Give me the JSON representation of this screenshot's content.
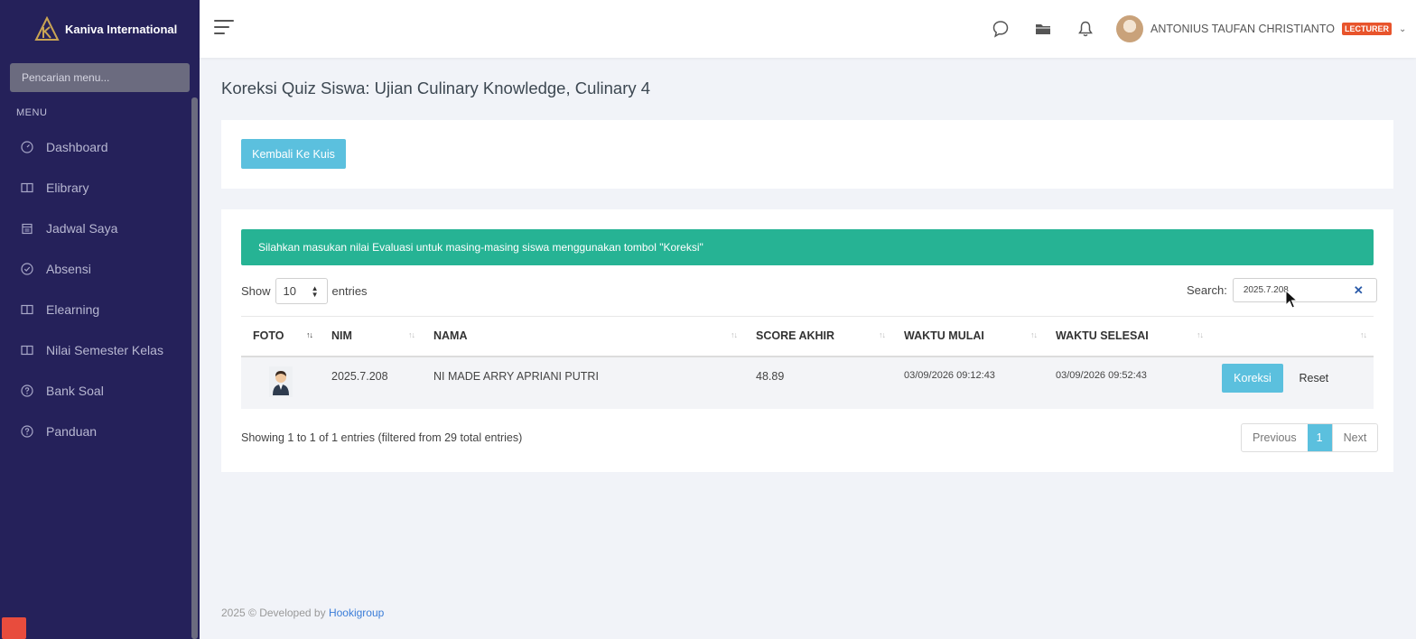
{
  "sidebar": {
    "brand": "Kaniva International",
    "search_placeholder": "Pencarian menu...",
    "menu_title": "MENU",
    "items": [
      {
        "label": "Dashboard",
        "icon": "dashboard-icon"
      },
      {
        "label": "Elibrary",
        "icon": "book-icon"
      },
      {
        "label": "Jadwal Saya",
        "icon": "calendar-icon"
      },
      {
        "label": "Absensi",
        "icon": "check-circle-icon"
      },
      {
        "label": "Elearning",
        "icon": "book-icon"
      },
      {
        "label": "Nilai Semester Kelas",
        "icon": "book-icon"
      },
      {
        "label": "Bank Soal",
        "icon": "question-circle-icon"
      },
      {
        "label": "Panduan",
        "icon": "question-circle-icon"
      }
    ]
  },
  "topbar": {
    "user_name": "ANTONIUS TAUFAN CHRISTIANTO",
    "role": "LECTURER"
  },
  "page": {
    "title": "Koreksi Quiz Siswa: Ujian Culinary Knowledge, Culinary 4",
    "back_button": "Kembali Ke Kuis",
    "alert": "Silahkan masukan nilai Evaluasi untuk masing-masing siswa menggunakan tombol \"Koreksi\""
  },
  "table_controls": {
    "show_label": "Show",
    "entries_value": "10",
    "entries_label": "entries",
    "search_label": "Search:",
    "search_value": "2025.7.208"
  },
  "table": {
    "headers": [
      "FOTO",
      "NIM",
      "NAMA",
      "SCORE AKHIR",
      "WAKTU MULAI",
      "WAKTU SELESAI",
      ""
    ],
    "rows": [
      {
        "nim": "2025.7.208",
        "nama": "NI MADE ARRY APRIANI PUTRI",
        "score": "48.89",
        "mulai": "03/09/2026 09:12:43",
        "selesai": "03/09/2026 09:52:43",
        "btn_koreksi": "Koreksi",
        "btn_reset": "Reset"
      }
    ]
  },
  "footer_info": {
    "showing": "Showing 1 to 1 of 1 entries (filtered from 29 total entries)",
    "prev": "Previous",
    "page": "1",
    "next": "Next"
  },
  "footer": {
    "text": "2025 © Developed by",
    "link": "Hookigroup"
  },
  "colors": {
    "sidebar_bg": "#25215a",
    "accent": "#5bc0de",
    "alert": "#26b394",
    "badge": "#e8542c"
  }
}
